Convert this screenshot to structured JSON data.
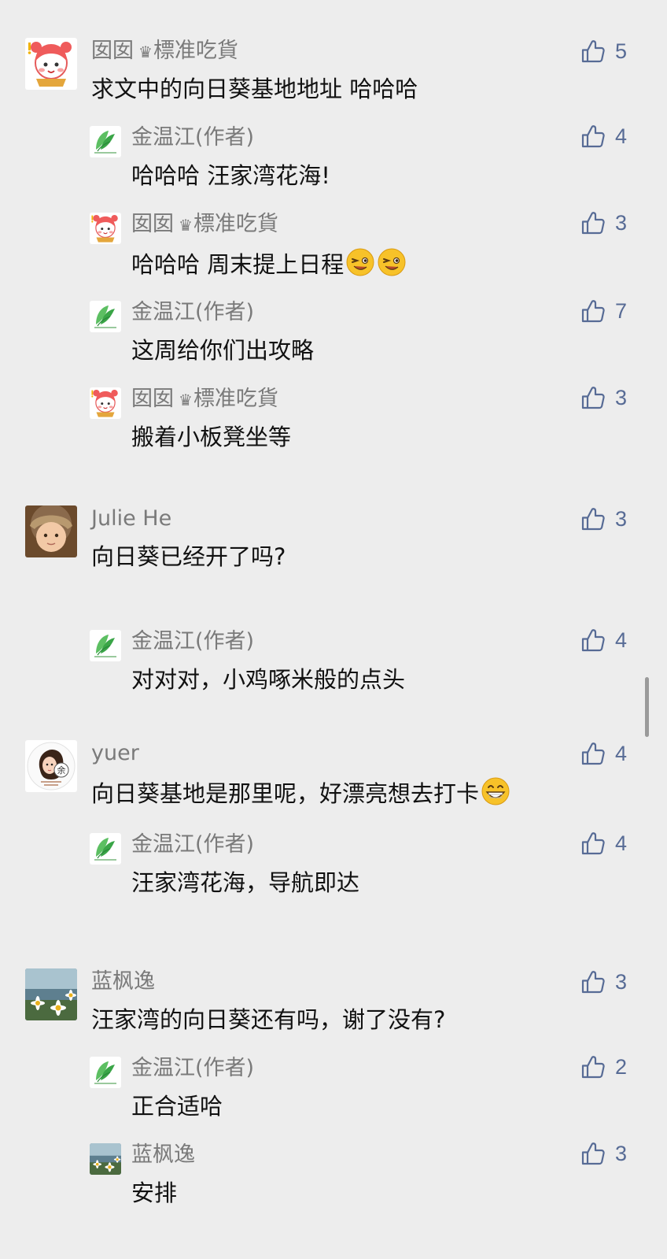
{
  "colors": {
    "background": "#ededed",
    "name_gray": "#7a7a7a",
    "like_blue": "#576b95"
  },
  "comments": [
    {
      "user": "囡囡",
      "badge_icon": "crown-icon",
      "badge": "標准吃貨",
      "text": "求文中的向日葵基地地址 哈哈哈",
      "likes": "5",
      "replies": [
        {
          "user": "金温江(作者)",
          "text": "哈哈哈 汪家湾花海!",
          "likes": "4"
        },
        {
          "user": "囡囡",
          "badge_icon": "crown-icon",
          "badge": "標准吃貨",
          "text": "哈哈哈 周末提上日程",
          "emoji": [
            "wink-emoji",
            "wink-emoji"
          ],
          "likes": "3"
        },
        {
          "user": "金温江(作者)",
          "text": "这周给你们出攻略",
          "likes": "7"
        },
        {
          "user": "囡囡",
          "badge_icon": "crown-icon",
          "badge": "標准吃貨",
          "text": "搬着小板凳坐等",
          "likes": "3"
        }
      ]
    },
    {
      "user": "Julie He",
      "text": "向日葵已经开了吗?",
      "likes": "3",
      "replies": [
        {
          "user": "金温江(作者)",
          "text": "对对对，小鸡啄米般的点头",
          "likes": "4"
        }
      ]
    },
    {
      "user": "yuer",
      "text": "向日葵基地是那里呢，好漂亮想去打卡",
      "emoji": [
        "grin-emoji"
      ],
      "likes": "4",
      "replies": [
        {
          "user": "金温江(作者)",
          "text": "汪家湾花海，导航即达",
          "likes": "4"
        }
      ]
    },
    {
      "user": "蓝枫逸",
      "text": "汪家湾的向日葵还有吗，谢了没有?",
      "likes": "3",
      "replies": [
        {
          "user": "金温江(作者)",
          "text": "正合适哈",
          "likes": "2"
        },
        {
          "user": "蓝枫逸",
          "text": "安排",
          "likes": "3"
        }
      ]
    }
  ]
}
